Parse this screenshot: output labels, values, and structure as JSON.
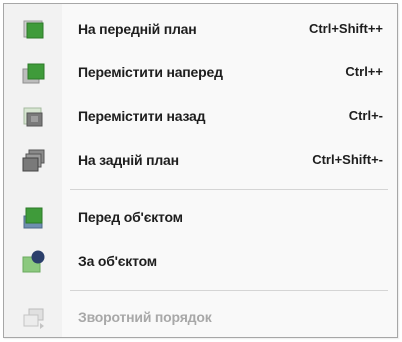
{
  "menu": {
    "items": [
      {
        "label": "На передній план",
        "shortcut": "Ctrl+Shift++",
        "icon": "bring-to-front-icon",
        "enabled": true
      },
      {
        "label": "Перемістити наперед",
        "shortcut": "Ctrl++",
        "icon": "bring-forward-icon",
        "enabled": true
      },
      {
        "label": "Перемістити назад",
        "shortcut": "Ctrl+-",
        "icon": "send-backward-icon",
        "enabled": true
      },
      {
        "label": "На задній план",
        "shortcut": "Ctrl+Shift+-",
        "icon": "send-to-back-icon",
        "enabled": true
      },
      {
        "label": "Перед об'єктом",
        "shortcut": "",
        "icon": "in-front-of-object-icon",
        "enabled": true
      },
      {
        "label": "За об'єктом",
        "shortcut": "",
        "icon": "behind-object-icon",
        "enabled": true
      },
      {
        "label": "Зворотний порядок",
        "shortcut": "",
        "icon": "reverse-order-icon",
        "enabled": false
      }
    ]
  },
  "colors": {
    "shape_green": "#3f9b3a",
    "shape_green_light": "#8cc97f",
    "shape_gray": "#8a8a8a",
    "shape_navy": "#2b3f6b",
    "disabled_text": "#a8a8a8"
  }
}
